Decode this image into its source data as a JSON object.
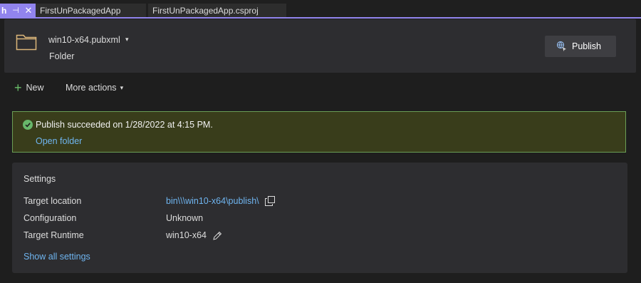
{
  "tabs": {
    "active": {
      "label": "h",
      "pin": "⊣",
      "close": "✕"
    },
    "items": [
      {
        "label": "FirstUnPackagedApp"
      },
      {
        "label": "FirstUnPackagedApp.csproj"
      }
    ]
  },
  "header": {
    "profile_name": "win10-x64.pubxml",
    "profile_caret": "▾",
    "profile_type": "Folder",
    "publish_label": "Publish",
    "folder_icon": "folder-icon",
    "publish_icon": "publish-globe-icon"
  },
  "actions": {
    "new_label": "New",
    "more_label": "More actions",
    "more_caret": "▾"
  },
  "banner": {
    "message": "Publish succeeded on 1/28/2022 at 4:15 PM.",
    "link": "Open folder",
    "status_color": "#68b76a"
  },
  "settings": {
    "title": "Settings",
    "rows": [
      {
        "label": "Target location",
        "value": "bin\\\\\\win10-x64\\publish\\"
      },
      {
        "label": "Configuration",
        "value": "Unknown"
      },
      {
        "label": "Target Runtime",
        "value": "win10-x64"
      }
    ],
    "show_all": "Show all settings"
  },
  "colors": {
    "accent": "#9184ee",
    "link": "#6fb5f0",
    "banner_bg": "#393d1b",
    "banner_border": "#6a9e55"
  }
}
